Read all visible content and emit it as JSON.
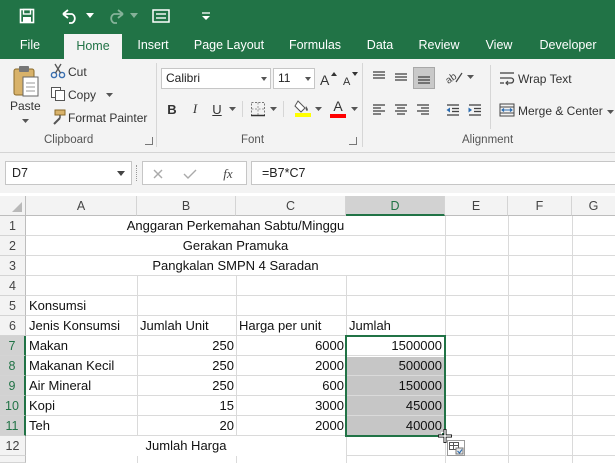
{
  "quick_access": {
    "save": "save-icon",
    "undo": "undo-icon",
    "redo": "redo-icon",
    "form": "form-icon",
    "customize": "customize-icon"
  },
  "tabs": [
    "File",
    "Home",
    "Insert",
    "Page Layout",
    "Formulas",
    "Data",
    "Review",
    "View",
    "Developer"
  ],
  "active_tab": "Home",
  "ribbon": {
    "clipboard": {
      "paste": "Paste",
      "cut": "Cut",
      "copy": "Copy",
      "format_painter": "Format Painter",
      "label": "Clipboard"
    },
    "font": {
      "font_name": "Calibri",
      "font_size": "11",
      "bold": "B",
      "italic": "I",
      "underline": "U",
      "font_color_letter": "A",
      "label": "Font",
      "highlight_color": "#ffff00",
      "text_color": "#ff0000"
    },
    "alignment": {
      "wrap_text": "Wrap Text",
      "merge_center": "Merge & Center",
      "label": "Alignment"
    }
  },
  "formula_bar": {
    "name_box": "D7",
    "fx": "fx",
    "formula": "=B7*C7"
  },
  "columns": [
    "A",
    "B",
    "C",
    "D",
    "E",
    "F",
    "G"
  ],
  "selected_column": "D",
  "rows": [
    "1",
    "2",
    "3",
    "4",
    "5",
    "6",
    "7",
    "8",
    "9",
    "10",
    "11",
    "12"
  ],
  "selected_rows": [
    "7",
    "8",
    "9",
    "10",
    "11"
  ],
  "sheet": {
    "title1": "Anggaran Perkemahan Sabtu/Minggu",
    "title2": "Gerakan Pramuka",
    "title3": "Pangkalan SMPN 4 Saradan",
    "section": "Konsumsi",
    "headers": [
      "Jenis Konsumsi",
      "Jumlah Unit",
      "Harga per unit",
      "Jumlah"
    ],
    "data": [
      [
        "Makan",
        "250",
        "6000",
        "1500000"
      ],
      [
        "Makanan Kecil",
        "250",
        "2000",
        "500000"
      ],
      [
        "Air Mineral",
        "250",
        "600",
        "150000"
      ],
      [
        "Kopi",
        "15",
        "3000",
        "45000"
      ],
      [
        "Teh",
        "20",
        "2000",
        "40000"
      ]
    ],
    "total_label": "Jumlah Harga"
  },
  "colors": {
    "excel_green": "#217346",
    "ribbon_bg": "#f3f3f3",
    "selection_shade": "#c6c6c6"
  }
}
